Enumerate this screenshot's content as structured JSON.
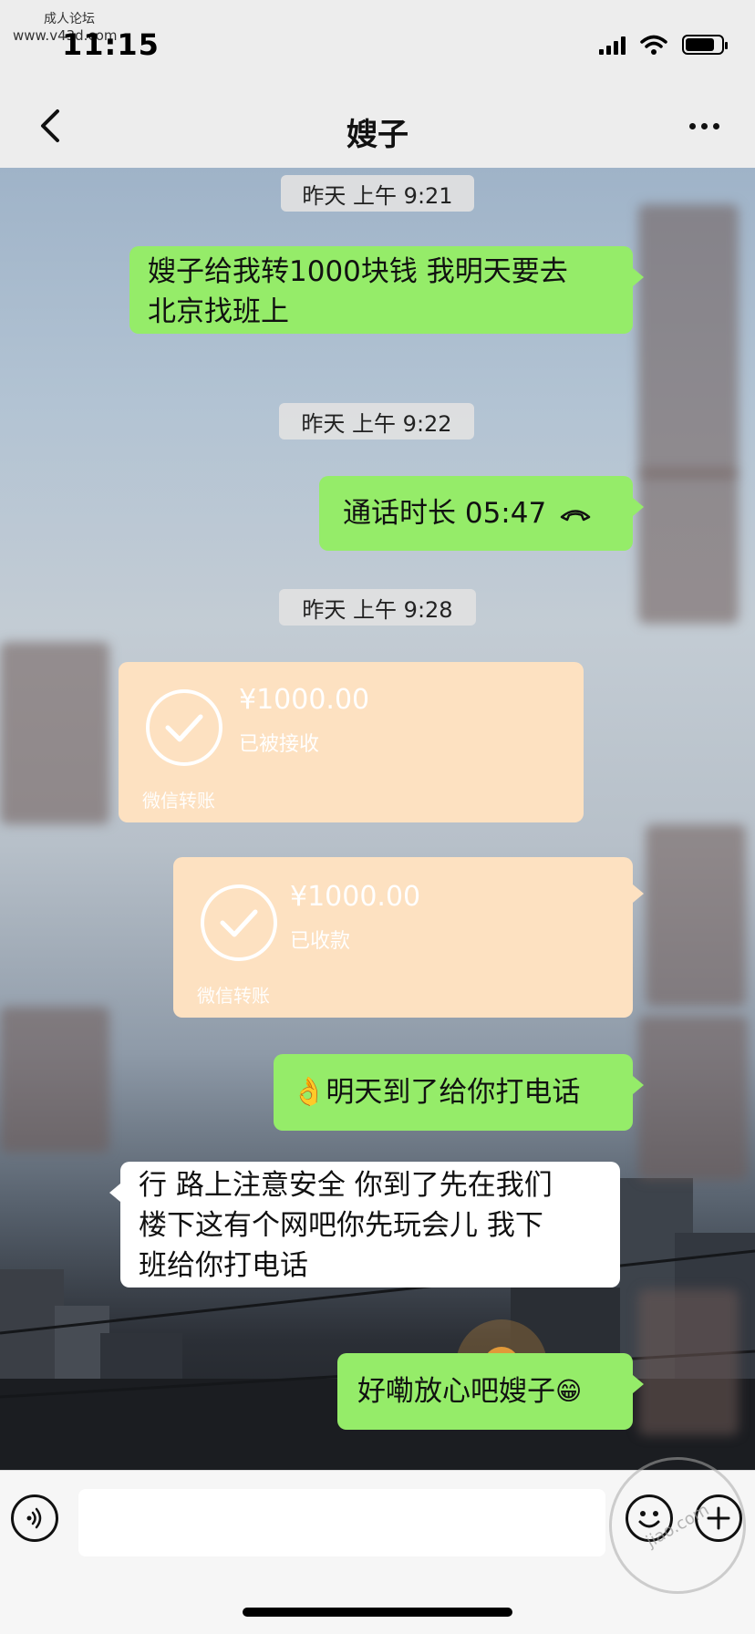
{
  "status_bar": {
    "watermark_title": "成人论坛",
    "watermark_url": "www.v43d.com",
    "time": "11:15"
  },
  "nav": {
    "title": "嫂子"
  },
  "messages": {
    "t1": "昨天 上午 9:21",
    "m1_line1": "嫂子给我转1000块钱 我明天要去",
    "m1_line2": "北京找班上",
    "t2": "昨天 上午 9:22",
    "call_text": "通话时长 05:47",
    "t3": "昨天 上午 9:28",
    "transfer1": {
      "amount": "¥1000.00",
      "status": "已被接收",
      "footer": "微信转账"
    },
    "transfer2": {
      "amount": "¥1000.00",
      "status": "已收款",
      "footer": "微信转账"
    },
    "m3_emoji": "👌",
    "m3_text": "明天到了给你打电话",
    "m4_line1": "行 路上注意安全 你到了先在我们",
    "m4_line2": "楼下这有个网吧你先玩会儿 我下",
    "m4_line3": "班给你打电话",
    "m5_text": "好嘞放心吧嫂子",
    "m5_emoji": "😁"
  },
  "input_bar": {
    "placeholder": ""
  },
  "watermark_stamp": "jiao.com",
  "colors": {
    "green_bubble": "#95ec69",
    "transfer_bubble": "#fde1c1",
    "bar_background": "#ededed"
  },
  "icons": [
    "back-arrow-icon",
    "more-dots-icon",
    "phone-hangup-icon",
    "check-circle-icon",
    "voice-icon",
    "emoji-icon",
    "plus-icon",
    "battery-icon",
    "wifi-icon",
    "signal-icon"
  ]
}
